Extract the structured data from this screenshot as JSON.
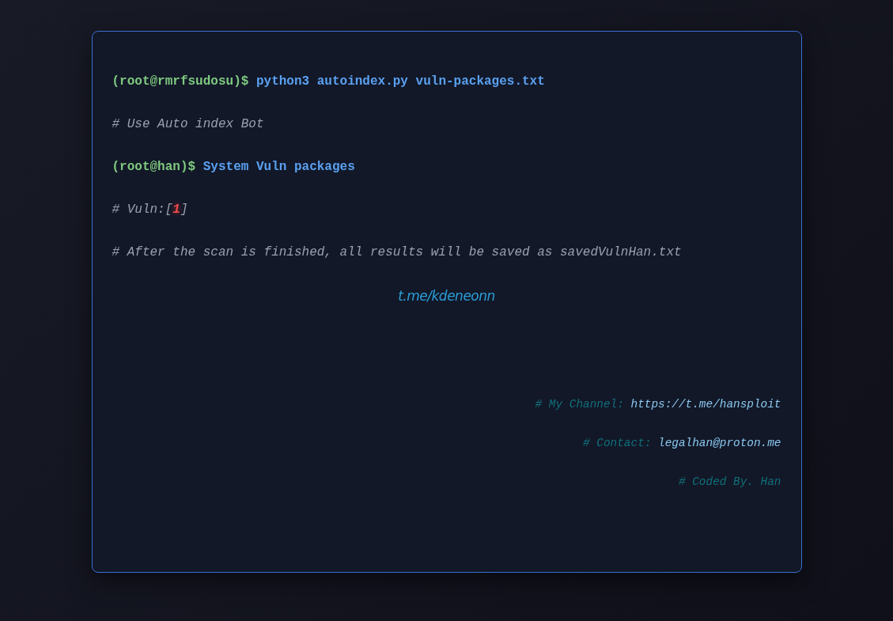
{
  "lines": [
    {
      "kind": "command",
      "prompt": "(root@rmrfsudosu)$",
      "command": "python3 autoindex.py vuln-packages.txt"
    },
    {
      "kind": "comment",
      "text": "# Use Auto index Bot"
    },
    {
      "kind": "command",
      "prompt": "(root@han)$",
      "command": "System Vuln packages"
    },
    {
      "kind": "count",
      "before": "# Vuln:[",
      "count": "1",
      "after": "]"
    },
    {
      "kind": "comment",
      "text": "# After the scan is finished, all results will be saved as savedVulnHan.txt"
    }
  ],
  "brand_link": "t.me/kdeneonn",
  "footer": [
    {
      "label": "# My Channel:",
      "value": "https://t.me/hansploit"
    },
    {
      "label": "# Contact:",
      "value": "legalhan@proton.me"
    },
    {
      "label": "# Coded By. Han"
    }
  ]
}
